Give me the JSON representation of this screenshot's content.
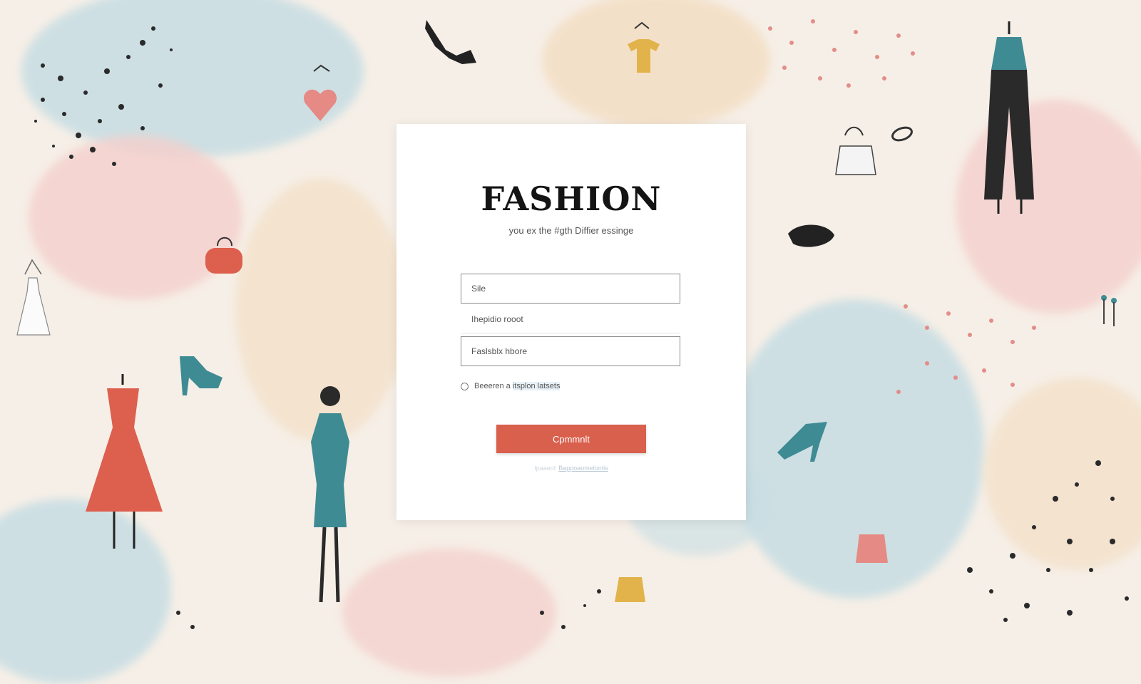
{
  "login_card": {
    "title": "FASHION",
    "subtitle": "you ex the #gth Diffier essinge",
    "field_1_value": "Sile",
    "field_2_value": "Ihepidio rooot",
    "field_3_value": "Faslsblx hbore",
    "checkbox_label_prefix": "Beeeren a ",
    "checkbox_label_highlight": "itsplon latsets",
    "checkbox_checked": false,
    "submit_label": "Cpmmnlt",
    "footer_prefix": "Ipaaeot",
    "footer_link": "Bappoaomelontis"
  },
  "colors": {
    "accent_button": "#d9604d",
    "title_text": "#141414",
    "background": "#f6efe7"
  },
  "background_icons": [
    "high-heel-shoe-icon",
    "tshirt-on-hanger-icon",
    "heart-on-hanger-icon",
    "mannequin-jumpsuit-icon",
    "handbag-icon",
    "ring-icon",
    "beret-hat-icon",
    "purse-icon",
    "dress-on-hanger-icon",
    "red-dress-mannequin-icon",
    "woman-silhouette-icon",
    "earrings-icon"
  ]
}
